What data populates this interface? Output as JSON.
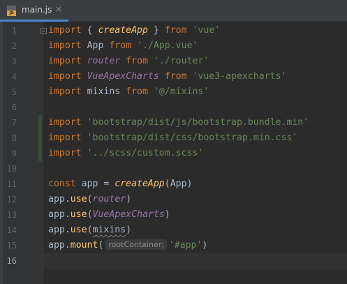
{
  "tab": {
    "icon_label": "JS",
    "file_name": "main.js",
    "close_glyph": "×"
  },
  "colors": {
    "keyword": "#cc7832",
    "string": "#6a8759",
    "function": "#ffc66d",
    "import_binding": "#9876aa",
    "identifier": "#a9b7c6",
    "background": "#2b2b2b",
    "gutter": "#313335"
  },
  "editor": {
    "current_line": "16",
    "lines": [
      {
        "num": "1",
        "tokens": [
          {
            "t": "import",
            "c": "kw"
          },
          {
            "t": " { ",
            "c": "id"
          },
          {
            "t": "createApp",
            "c": "fn-it"
          },
          {
            "t": " } ",
            "c": "id"
          },
          {
            "t": "from",
            "c": "kw"
          },
          {
            "t": " ",
            "c": "id"
          },
          {
            "t": "'vue'",
            "c": "str"
          }
        ]
      },
      {
        "num": "2",
        "tokens": [
          {
            "t": "import",
            "c": "kw"
          },
          {
            "t": " App ",
            "c": "id"
          },
          {
            "t": "from",
            "c": "kw"
          },
          {
            "t": " ",
            "c": "id"
          },
          {
            "t": "'./App.vue'",
            "c": "str"
          }
        ]
      },
      {
        "num": "3",
        "tokens": [
          {
            "t": "import",
            "c": "kw"
          },
          {
            "t": " ",
            "c": "id"
          },
          {
            "t": "router",
            "c": "imp-it"
          },
          {
            "t": " ",
            "c": "id"
          },
          {
            "t": "from",
            "c": "kw"
          },
          {
            "t": " ",
            "c": "id"
          },
          {
            "t": "'./router'",
            "c": "str"
          }
        ]
      },
      {
        "num": "4",
        "tokens": [
          {
            "t": "import",
            "c": "kw"
          },
          {
            "t": " ",
            "c": "id"
          },
          {
            "t": "VueApexCharts",
            "c": "imp-it"
          },
          {
            "t": " ",
            "c": "id"
          },
          {
            "t": "from",
            "c": "kw"
          },
          {
            "t": " ",
            "c": "id"
          },
          {
            "t": "'vue3-apexcharts'",
            "c": "str"
          }
        ]
      },
      {
        "num": "5",
        "tokens": [
          {
            "t": "import",
            "c": "kw"
          },
          {
            "t": " mixins ",
            "c": "id"
          },
          {
            "t": "from",
            "c": "kw"
          },
          {
            "t": " ",
            "c": "id"
          },
          {
            "t": "'@/mixins'",
            "c": "str"
          }
        ]
      },
      {
        "num": "6",
        "tokens": []
      },
      {
        "num": "7",
        "tokens": [
          {
            "t": "import",
            "c": "kw"
          },
          {
            "t": " ",
            "c": "id"
          },
          {
            "t": "'bootstrap/dist/js/bootstrap.bundle.min'",
            "c": "str"
          }
        ]
      },
      {
        "num": "8",
        "tokens": [
          {
            "t": "import",
            "c": "kw"
          },
          {
            "t": " ",
            "c": "id"
          },
          {
            "t": "'bootstrap/dist/css/bootstrap.min.css'",
            "c": "str"
          }
        ]
      },
      {
        "num": "9",
        "tokens": [
          {
            "t": "import",
            "c": "kw"
          },
          {
            "t": " ",
            "c": "id"
          },
          {
            "t": "'../scss/custom.scss'",
            "c": "str"
          }
        ]
      },
      {
        "num": "10",
        "tokens": []
      },
      {
        "num": "11",
        "tokens": [
          {
            "t": "const",
            "c": "kw"
          },
          {
            "t": " app = ",
            "c": "id"
          },
          {
            "t": "createApp",
            "c": "fn-it"
          },
          {
            "t": "(App)",
            "c": "id"
          }
        ]
      },
      {
        "num": "12",
        "tokens": [
          {
            "t": "app.",
            "c": "id"
          },
          {
            "t": "use",
            "c": "method"
          },
          {
            "t": "(",
            "c": "id"
          },
          {
            "t": "router",
            "c": "imp-it"
          },
          {
            "t": ")",
            "c": "id"
          }
        ]
      },
      {
        "num": "13",
        "tokens": [
          {
            "t": "app.",
            "c": "id"
          },
          {
            "t": "use",
            "c": "method"
          },
          {
            "t": "(",
            "c": "id"
          },
          {
            "t": "VueApexCharts",
            "c": "imp-it"
          },
          {
            "t": ")",
            "c": "id"
          }
        ]
      },
      {
        "num": "14",
        "tokens": [
          {
            "t": "app.",
            "c": "id"
          },
          {
            "t": "use",
            "c": "method"
          },
          {
            "t": "(",
            "c": "id"
          },
          {
            "t": "mixins",
            "c": "id squiggle"
          },
          {
            "t": ")",
            "c": "id"
          }
        ]
      },
      {
        "num": "15",
        "tokens": [
          {
            "t": "app.",
            "c": "id"
          },
          {
            "t": "mount",
            "c": "method"
          },
          {
            "t": "(",
            "c": "id"
          },
          {
            "t": "rootContainer:",
            "c": "param-hint"
          },
          {
            "t": "'#app'",
            "c": "str"
          },
          {
            "t": ")",
            "c": "id"
          }
        ]
      },
      {
        "num": "16",
        "tokens": []
      }
    ]
  }
}
